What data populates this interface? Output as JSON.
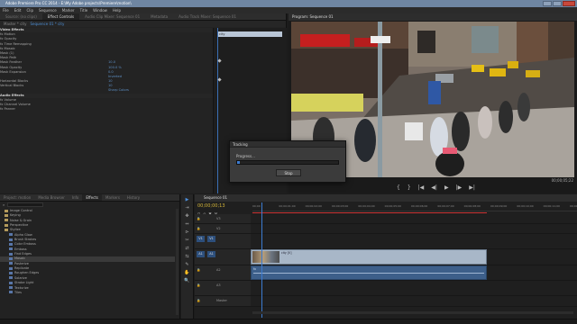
{
  "app": {
    "title": "Adobe Premiere Pro CC 2014 - E:\\My Adobe projects\\Premiere\\motion\\",
    "menu": [
      "File",
      "Edit",
      "Clip",
      "Sequence",
      "Marker",
      "Title",
      "Window",
      "Help"
    ]
  },
  "effect_controls": {
    "tabs": [
      "Source: (no clips)",
      "Effect Controls",
      "Audio Clip Mixer: Sequence 01",
      "Metadata",
      "Audio Track Mixer: Sequence 01"
    ],
    "header": {
      "master": "Master * city",
      "sequence": "Sequence 01 * city"
    },
    "rows": [
      {
        "label": "Video Effects",
        "section": true
      },
      {
        "label": "fx  Motion"
      },
      {
        "label": "fx  Opacity"
      },
      {
        "label": "fx  Time Remapping"
      },
      {
        "label": "fx  Mosaic"
      },
      {
        "label": "   Mask (1)"
      },
      {
        "label": "      Mask Path"
      },
      {
        "label": "      Mask Feather",
        "value": "10.0"
      },
      {
        "label": "      Mask Opacity",
        "value": "100.0 %"
      },
      {
        "label": "      Mask Expansion",
        "value": "0.0"
      },
      {
        "label": "",
        "value": "Inverted"
      },
      {
        "label": "   Horizontal Blocks",
        "value": "10"
      },
      {
        "label": "   Vertical Blocks",
        "value": "10"
      },
      {
        "label": "",
        "value": "Sharp Colors"
      },
      {
        "label": "Audio Effects",
        "section": true
      },
      {
        "label": "fx  Volume"
      },
      {
        "label": "fx  Channel Volume"
      },
      {
        "label": "fx  Panner"
      }
    ],
    "clip_label": "city",
    "timecode": "00;00;00;13"
  },
  "program_monitor": {
    "tab": "Program: Sequence 01",
    "timecode": "00;00;00;13",
    "duration": "00;00;05;22",
    "transport": [
      "{",
      "}",
      "|◀",
      "◀|",
      "▶",
      "|▶",
      "▶|"
    ]
  },
  "tracking_dialog": {
    "title": "Tracking",
    "message": "Progress...",
    "progress": 0.03,
    "stop_label": "Stop"
  },
  "effects_panel": {
    "tabs": [
      "Project: motion",
      "Media Browser",
      "Info",
      "Effects",
      "Markers",
      "History"
    ],
    "items": [
      {
        "label": "Image Control",
        "type": "folder",
        "indent": 1
      },
      {
        "label": "Keying",
        "type": "folder",
        "indent": 1
      },
      {
        "label": "Noise & Grain",
        "type": "folder",
        "indent": 1
      },
      {
        "label": "Perspective",
        "type": "folder",
        "indent": 1
      },
      {
        "label": "Stylize",
        "type": "folder",
        "indent": 1,
        "open": true
      },
      {
        "label": "Alpha Glow",
        "type": "fx",
        "indent": 2
      },
      {
        "label": "Brush Strokes",
        "type": "fx",
        "indent": 2
      },
      {
        "label": "Color Emboss",
        "type": "fx",
        "indent": 2
      },
      {
        "label": "Emboss",
        "type": "fx",
        "indent": 2
      },
      {
        "label": "Find Edges",
        "type": "fx",
        "indent": 2
      },
      {
        "label": "Mosaic",
        "type": "fx",
        "indent": 2,
        "selected": true
      },
      {
        "label": "Posterize",
        "type": "fx",
        "indent": 2
      },
      {
        "label": "Replicate",
        "type": "fx",
        "indent": 2
      },
      {
        "label": "Roughen Edges",
        "type": "fx",
        "indent": 2
      },
      {
        "label": "Solarize",
        "type": "fx",
        "indent": 2
      },
      {
        "label": "Strobe Light",
        "type": "fx",
        "indent": 2
      },
      {
        "label": "Texturize",
        "type": "fx",
        "indent": 2
      },
      {
        "label": "Tiles",
        "type": "fx",
        "indent": 2
      }
    ]
  },
  "tools": [
    "▶",
    "⇥",
    "✥",
    "⇔",
    "⊳",
    "✂",
    "⇄",
    "⇆",
    "✎",
    "✋",
    "🔍"
  ],
  "timeline": {
    "tab": "Sequence 01",
    "timecode": "00;00;00;13",
    "ruler": [
      "00;00",
      "00;00;01;00",
      "00;00;02;00",
      "00;00;03;00",
      "00;00;04;00",
      "00;00;05;00",
      "00;00;06;00",
      "00;00;07;00",
      "00;00;08;00",
      "00;00;09;00",
      "00;00;10;00",
      "00;00;11;00",
      "00;00;12;00"
    ],
    "tracks": [
      {
        "name": "V3",
        "target": false
      },
      {
        "name": "V2",
        "target": false
      },
      {
        "name": "V1",
        "target": true,
        "source": "V1"
      },
      {
        "name": "A1",
        "target": true,
        "source": "A1"
      },
      {
        "name": "A2",
        "target": false
      },
      {
        "name": "A3",
        "target": false
      },
      {
        "name": "Master",
        "target": false
      }
    ],
    "video_clip_label": "city [V]",
    "audio_clip_label": "fx"
  }
}
